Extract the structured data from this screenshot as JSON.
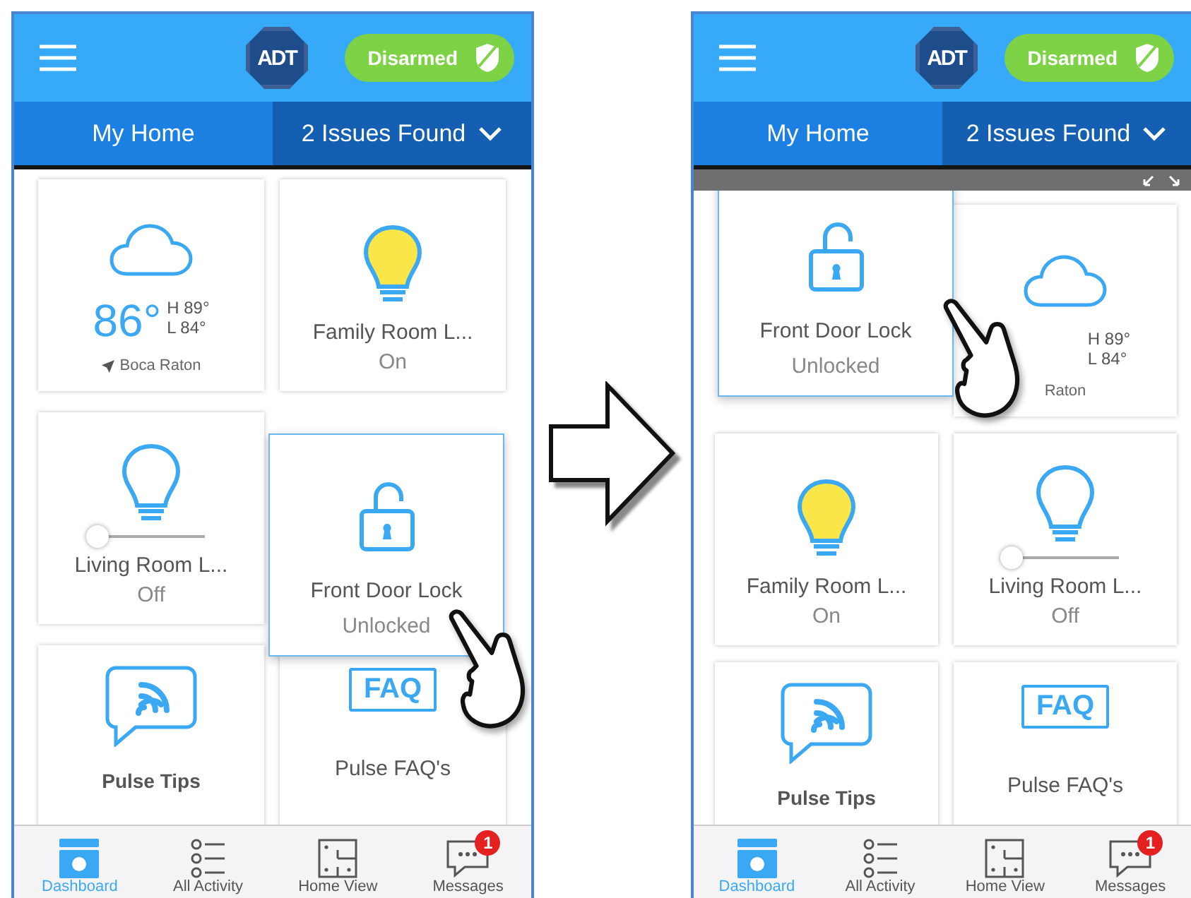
{
  "phones": [
    {
      "header": {
        "logo": "ADT",
        "status": "Disarmed"
      },
      "tabs": [
        {
          "label": "My Home",
          "selected": true
        },
        {
          "label": "2 Issues Found",
          "selected": false
        }
      ],
      "tiles": [
        {
          "kind": "weather",
          "temperature": "86°",
          "high": "H 89°",
          "low": "L 84°",
          "location": "Boca Raton",
          "pin": true
        },
        {
          "kind": "light",
          "name": "Family Room L...",
          "status": "On",
          "on": true
        },
        {
          "kind": "dimmer",
          "name": "Living Room L...",
          "status": "Off",
          "on": false,
          "level": 0
        },
        {
          "kind": "empty"
        },
        {
          "kind": "tips",
          "name": "Pulse Tips"
        },
        {
          "kind": "faq",
          "badge": "FAQ",
          "name": "Pulse FAQ's"
        }
      ],
      "dragged": {
        "name": "Front Door Lock",
        "status": "Unlocked"
      },
      "nav": [
        {
          "label": "Dashboard",
          "selected": true
        },
        {
          "label": "All Activity",
          "selected": false
        },
        {
          "label": "Home View",
          "selected": false
        },
        {
          "label": "Messages",
          "selected": false,
          "badge": "1"
        }
      ]
    },
    {
      "header": {
        "logo": "ADT",
        "status": "Disarmed"
      },
      "tabs": [
        {
          "label": "My Home",
          "selected": true
        },
        {
          "label": "2 Issues Found",
          "selected": false
        }
      ],
      "drag_bar": true,
      "tiles": [
        {
          "kind": "empty"
        },
        {
          "kind": "weather",
          "high": "H 89°",
          "low": "L 84°",
          "location": "Raton",
          "pin": false
        },
        {
          "kind": "light",
          "name": "Family Room L...",
          "status": "On",
          "on": true
        },
        {
          "kind": "dimmer",
          "name": "Living Room L...",
          "status": "Off",
          "on": false,
          "level": 0
        },
        {
          "kind": "tips",
          "name": "Pulse Tips"
        },
        {
          "kind": "faq",
          "badge": "FAQ",
          "name": "Pulse FAQ's"
        }
      ],
      "dragged": {
        "name": "Front Door Lock",
        "status": "Unlocked"
      },
      "nav": [
        {
          "label": "Dashboard",
          "selected": true
        },
        {
          "label": "All Activity",
          "selected": false
        },
        {
          "label": "Home View",
          "selected": false
        },
        {
          "label": "Messages",
          "selected": false,
          "badge": "1"
        }
      ]
    }
  ]
}
